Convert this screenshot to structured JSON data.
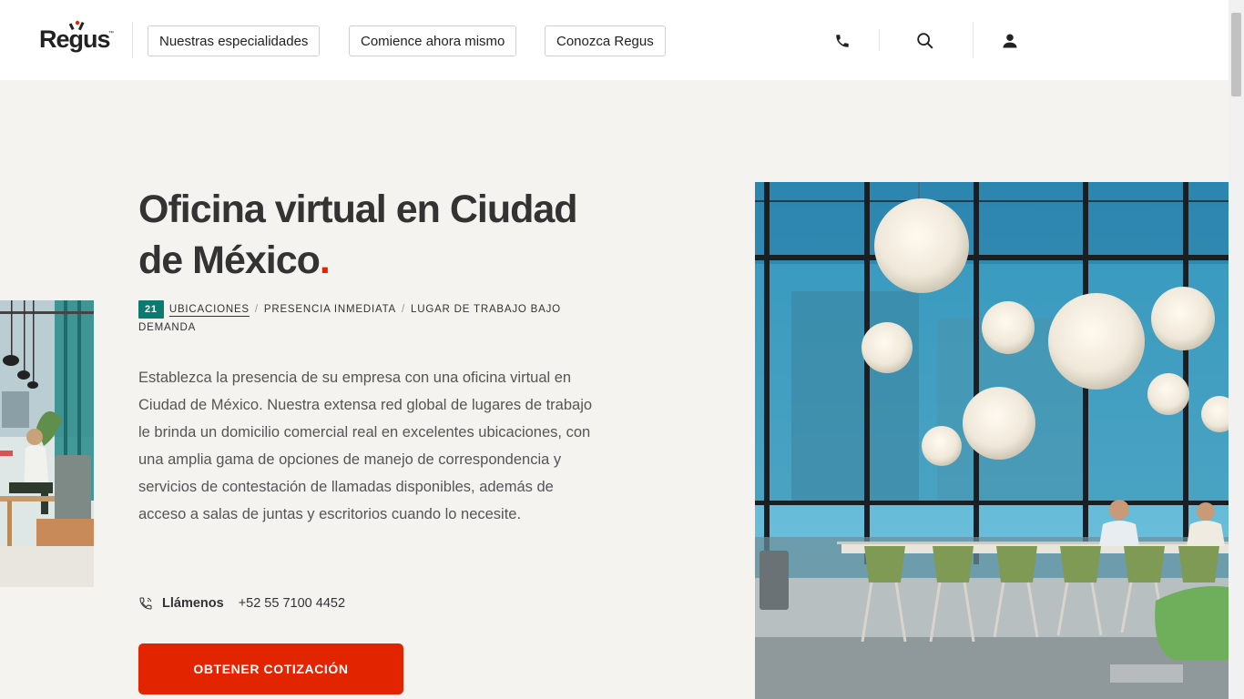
{
  "brand": {
    "logo_text": "Regus",
    "logo_tm": "™",
    "accent": "#e32400",
    "teal": "#0d7a72"
  },
  "nav": {
    "items": [
      {
        "label": "Nuestras especialidades"
      },
      {
        "label": "Comience ahora mismo"
      },
      {
        "label": "Conozca Regus"
      }
    ],
    "icons": [
      "phone-icon",
      "search-icon",
      "user-icon"
    ]
  },
  "hero": {
    "title": "Oficina virtual en Ciudad de México",
    "title_dot": ".",
    "badge_count": "21",
    "crumbs": [
      "Ubicaciones",
      "Presencia inmediata",
      "Lugar de trabajo bajo demanda"
    ],
    "separator": "/",
    "description": "Establezca la presencia de su empresa con una oficina virtual en Ciudad de México. Nuestra extensa red global de lugares de trabajo le brinda un domicilio comercial real en excelentes ubicaciones, con una amplia gama de opciones de manejo de correspondencia y servicios de contestación de llamadas disponibles, además de acceso a salas de juntas y escritorios cuando lo necesite.",
    "call_label": "Llámenos",
    "phone": "+52 55 7100 4452",
    "cta_label": "OBTENER COTIZACIÓN"
  }
}
